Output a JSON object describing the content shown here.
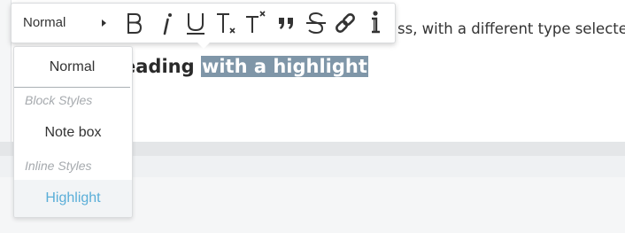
{
  "editor": {
    "paragraph_tail": "ss, with a different type selected",
    "heading_start": "eading",
    "heading_highlight": "with a highlight"
  },
  "toolbar": {
    "style_value": "Normal",
    "buttons": [
      {
        "name": "bold",
        "icon": "bold-icon"
      },
      {
        "name": "italic",
        "icon": "italic-icon"
      },
      {
        "name": "underline",
        "icon": "underline-icon"
      },
      {
        "name": "subscript",
        "icon": "subscript-icon"
      },
      {
        "name": "superscript",
        "icon": "superscript-icon"
      },
      {
        "name": "blockquote",
        "icon": "quote-icon"
      },
      {
        "name": "strikethrough",
        "icon": "strikethrough-icon"
      },
      {
        "name": "link",
        "icon": "link-icon"
      },
      {
        "name": "info",
        "icon": "info-icon"
      }
    ]
  },
  "dropdown": {
    "normal": "Normal",
    "block_styles_label": "Block Styles",
    "note_box": "Note box",
    "inline_styles_label": "Inline Styles",
    "highlight": "Highlight",
    "highlight_color": "#5aaed8"
  }
}
